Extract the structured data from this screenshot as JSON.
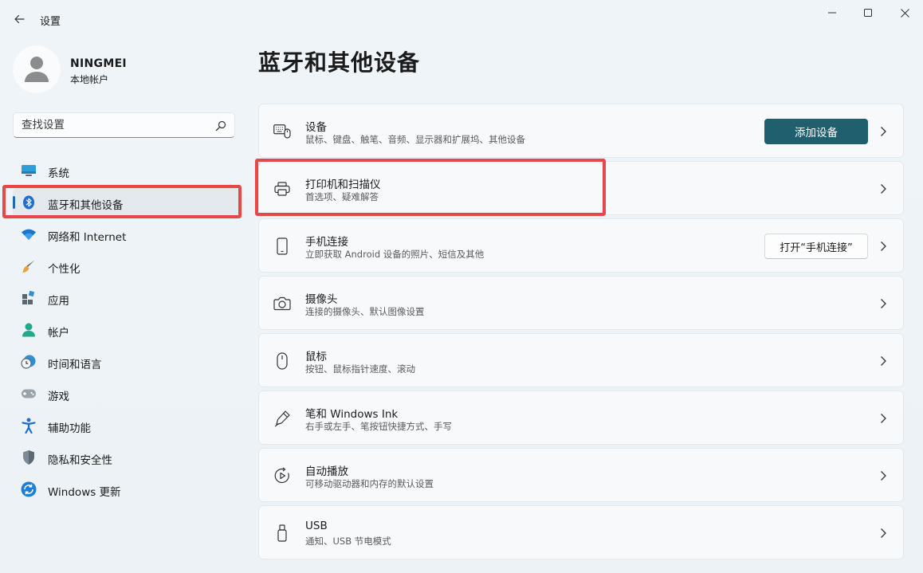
{
  "window": {
    "title": "设置",
    "back_icon": "arrow-left-icon",
    "minimize_icon": "minimize-icon",
    "maximize_icon": "maximize-icon",
    "close_icon": "close-icon"
  },
  "profile": {
    "name": "NINGMEI",
    "account_type": "本地帐户",
    "avatar_icon": "person-icon"
  },
  "search": {
    "placeholder": "查找设置",
    "icon": "search-icon"
  },
  "sidebar": {
    "items": [
      {
        "label": "系统",
        "icon": "system-display-icon",
        "selected": false
      },
      {
        "label": "蓝牙和其他设备",
        "icon": "bluetooth-icon",
        "selected": true
      },
      {
        "label": "网络和 Internet",
        "icon": "wifi-icon",
        "selected": false
      },
      {
        "label": "个性化",
        "icon": "brush-icon",
        "selected": false
      },
      {
        "label": "应用",
        "icon": "apps-icon",
        "selected": false
      },
      {
        "label": "帐户",
        "icon": "account-icon",
        "selected": false
      },
      {
        "label": "时间和语言",
        "icon": "time-language-icon",
        "selected": false
      },
      {
        "label": "游戏",
        "icon": "gamepad-icon",
        "selected": false
      },
      {
        "label": "辅助功能",
        "icon": "accessibility-icon",
        "selected": false
      },
      {
        "label": "隐私和安全性",
        "icon": "shield-icon",
        "selected": false
      },
      {
        "label": "Windows 更新",
        "icon": "update-icon",
        "selected": false
      }
    ]
  },
  "main": {
    "title": "蓝牙和其他设备",
    "cards": [
      {
        "title": "设备",
        "subtitle": "鼠标、键盘、触笔、音频、显示器和扩展坞、其他设备",
        "icon": "devices-icon",
        "button": "添加设备"
      },
      {
        "title": "打印机和扫描仪",
        "subtitle": "首选项、疑难解答",
        "icon": "printer-icon"
      },
      {
        "title": "手机连接",
        "subtitle": "立即获取 Android 设备的照片、短信及其他",
        "icon": "phone-icon",
        "button": "打开“手机连接”"
      },
      {
        "title": "摄像头",
        "subtitle": "连接的摄像头、默认图像设置",
        "icon": "camera-icon"
      },
      {
        "title": "鼠标",
        "subtitle": "按钮、鼠标指针速度、滚动",
        "icon": "mouse-icon"
      },
      {
        "title": "笔和 Windows Ink",
        "subtitle": "右手或左手、笔按钮快捷方式、手写",
        "icon": "pen-icon"
      },
      {
        "title": "自动播放",
        "subtitle": "可移动驱动器和内存的默认设置",
        "icon": "autoplay-icon"
      },
      {
        "title": "USB",
        "subtitle": "通知、USB 节电模式",
        "icon": "usb-icon"
      }
    ]
  },
  "colors": {
    "accent": "#1f5f6e",
    "highlight": "#e8474a",
    "selection_indicator": "#1f6bb0"
  }
}
